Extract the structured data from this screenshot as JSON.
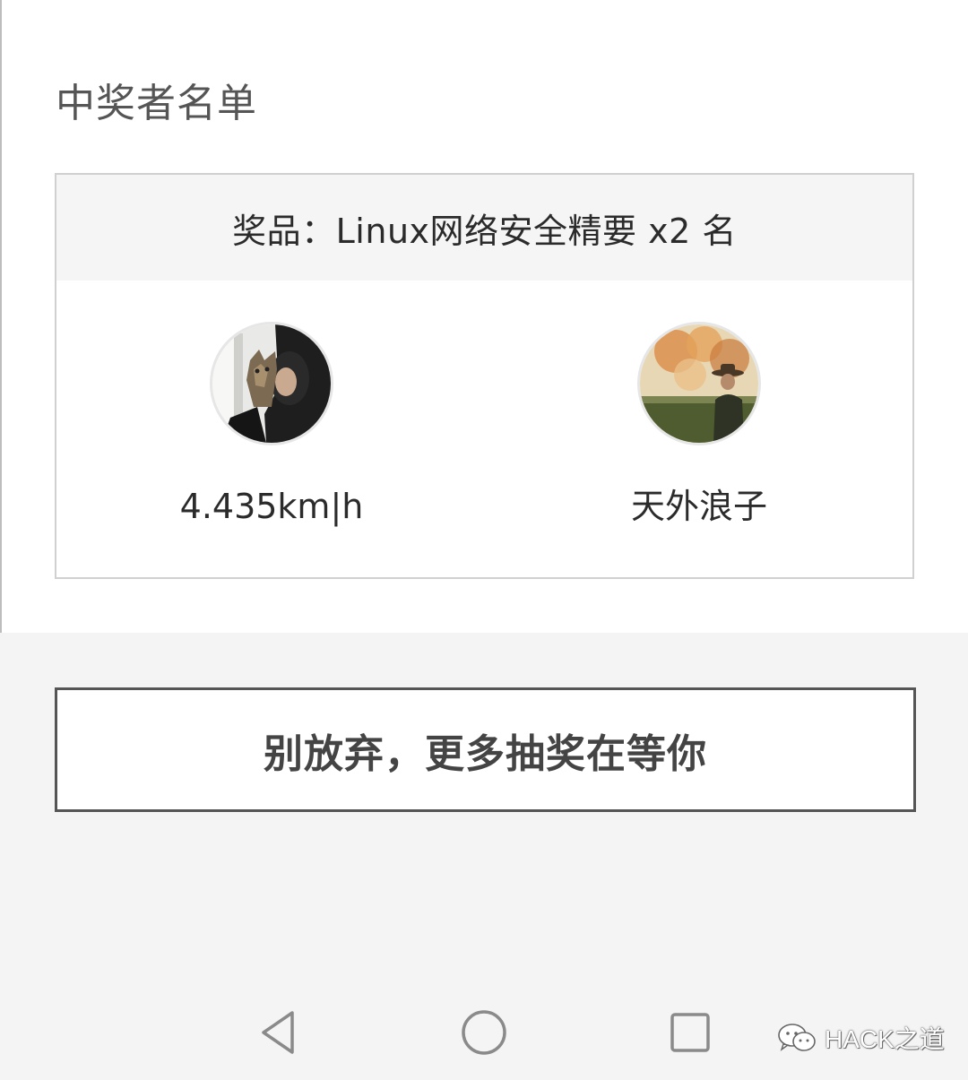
{
  "section": {
    "title": "中奖者名单"
  },
  "prize": {
    "header": "奖品：Linux网络安全精要 x2 名"
  },
  "winners": [
    {
      "name": "4.435km|h",
      "avatar_icon": "avatar-person-with-cat"
    },
    {
      "name": "天外浪子",
      "avatar_icon": "avatar-person-in-field"
    }
  ],
  "actions": {
    "more_lottery_label": "别放弃，更多抽奖在等你"
  },
  "navbar": {
    "back_icon": "back-triangle-icon",
    "home_icon": "home-circle-icon",
    "recent_icon": "recent-square-icon"
  },
  "watermark": {
    "text": "HACK之道",
    "icon": "wechat-icon"
  },
  "colors": {
    "page_bg": "#f4f4f4",
    "card_border": "#d0d0d0",
    "header_bg": "#f5f5f5",
    "button_border": "#555555",
    "text_dark": "#2b2b2b"
  }
}
